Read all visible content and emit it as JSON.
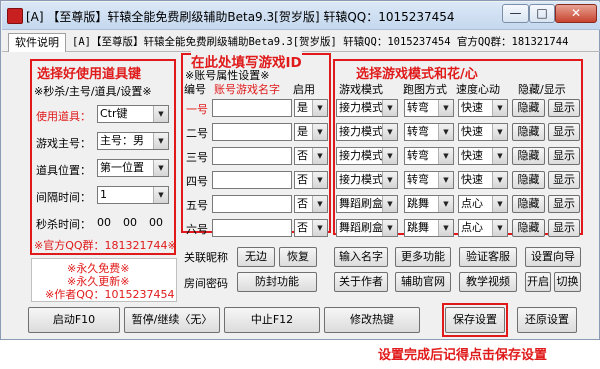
{
  "title_bar": {
    "title": "[A] 【至尊版】轩辕全能免费刷级辅助Beta9.3[贺岁版]   轩辕QQ：1015237454",
    "min_label": "—",
    "max_label": "□",
    "close_label": "✕"
  },
  "tab": {
    "label": "软件说明"
  },
  "marquee": {
    "text": "[A]【至尊版】轩辕全能免费刷级辅助Beta9.3[贺岁版] 轩辕QQ：1015237454 官方QQ群：181321744"
  },
  "left_panel": {
    "heading": "选择好使用道具键",
    "subheading": "※秒杀/主号/道具/设置※",
    "item_key_label": "使用道具：",
    "item_key_value": "Ctr键",
    "main_acc_label": "游戏主号：",
    "main_acc_value": "主号：男",
    "item_pos_label": "道具位置：",
    "item_pos_value": "第一位置",
    "interval_label": "间隔时间：",
    "interval_value": "1",
    "seckill_label": "秒杀时间：",
    "seckill_h": "00",
    "seckill_m": "00",
    "seckill_s": "00",
    "qq_group": "※官方QQ群：181321744※"
  },
  "promo": {
    "line1": "※永久免费※",
    "line2": "※永久更新※",
    "line3": "※作者QQ：1015237454"
  },
  "mid_panel": {
    "heading": "在此处填写游戏ID",
    "attr_title": "※账号属性设置※",
    "col_num": "编号",
    "col_name": "账号游戏名字",
    "col_enable": "启用",
    "rows": [
      {
        "num": "一号",
        "enable": "是"
      },
      {
        "num": "二号",
        "enable": "是"
      },
      {
        "num": "三号",
        "enable": "否"
      },
      {
        "num": "四号",
        "enable": "否"
      },
      {
        "num": "五号",
        "enable": "否"
      },
      {
        "num": "六号",
        "enable": "否"
      }
    ]
  },
  "right_panel": {
    "heading": "选择游戏模式和花/心",
    "col_mode": "游戏模式",
    "col_jump": "跑图方式",
    "col_speed": "速度心动",
    "col_hide": "隐藏/显示",
    "rows": [
      {
        "mode": "接力模式",
        "jump": "转弯",
        "speed": "快速",
        "hide": "隐藏",
        "show": "显示"
      },
      {
        "mode": "接力模式",
        "jump": "转弯",
        "speed": "快速",
        "hide": "隐藏",
        "show": "显示"
      },
      {
        "mode": "接力模式",
        "jump": "转弯",
        "speed": "快速",
        "hide": "隐藏",
        "show": "显示"
      },
      {
        "mode": "接力模式",
        "jump": "转弯",
        "speed": "快速",
        "hide": "隐藏",
        "show": "显示"
      },
      {
        "mode": "舞蹈刷盒",
        "jump": "跳舞",
        "speed": "点心",
        "hide": "隐藏",
        "show": "显示"
      },
      {
        "mode": "舞蹈刷盒",
        "jump": "跳舞",
        "speed": "点心",
        "hide": "隐藏",
        "show": "显示"
      }
    ]
  },
  "lower": {
    "nick_label": "关联昵称",
    "nick_none": "无边",
    "nick_restore": "恢复",
    "room_label": "房间密码",
    "anti_seal": "防封功能",
    "input_name": "输入名字",
    "more_func": "更多功能",
    "verify": "验证客服",
    "setup_wizard": "设置向导",
    "about": "关于作者",
    "official_site": "辅助官网",
    "tutorial": "教学视频",
    "open": "开启",
    "switch": "切换"
  },
  "bottom": {
    "start": "启动F10",
    "pause": "暂停/继续〈无〉",
    "stop": "中止F12",
    "hotkey": "修改热键",
    "save": "保存设置",
    "restore": "还原设置"
  },
  "caption": "设置完成后记得点击保存设置",
  "colors": {
    "accent_red": "#e01a1a",
    "window_bg": "#f0f0f0"
  }
}
